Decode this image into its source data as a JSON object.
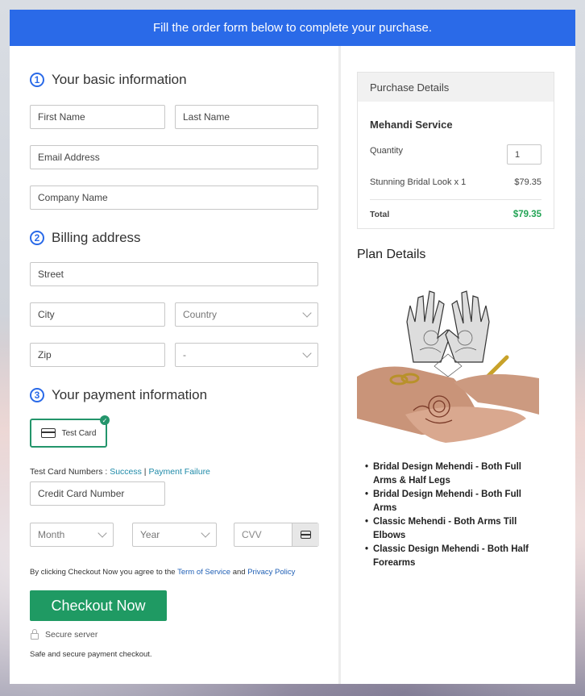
{
  "banner": "Fill the order form below to complete your purchase.",
  "sections": {
    "basic": {
      "number": "1",
      "title": "Your basic information"
    },
    "billing": {
      "number": "2",
      "title": "Billing address"
    },
    "payment": {
      "number": "3",
      "title": "Your payment information"
    }
  },
  "fields": {
    "first_name": "First Name",
    "last_name": "Last Name",
    "email": "Email Address",
    "company": "Company Name",
    "street": "Street",
    "city": "City",
    "country": "Country",
    "zip": "Zip",
    "state": "-",
    "card_number": "Credit Card Number",
    "month": "Month",
    "year": "Year",
    "cvv": "CVV"
  },
  "payment": {
    "test_card_label": "Test Card",
    "test_numbers_prefix": "Test Card Numbers : ",
    "success_link": "Success",
    "separator": " | ",
    "failure_link": "Payment Failure"
  },
  "terms": {
    "prefix": "By clicking Checkout Now you agree to the ",
    "tos": "Term of Service",
    "and": " and ",
    "privacy": "Privacy Policy"
  },
  "checkout_label": "Checkout Now",
  "secure_server": "Secure server",
  "safe_text": "Safe and secure payment checkout.",
  "purchase": {
    "header": "Purchase Details",
    "product": "Mehandi Service",
    "quantity_label": "Quantity",
    "quantity_value": "1",
    "item_label": "Stunning Bridal Look x 1",
    "item_price": "$79.35",
    "total_label": "Total",
    "total_value": "$79.35"
  },
  "plan": {
    "title": "Plan Details",
    "features": [
      "Bridal Design Mehendi - Both Full Arms & Half Legs",
      "Bridal Design Mehendi - Both Full Arms",
      "Classic Mehendi - Both Arms Till Elbows",
      "Classic Design Mehendi - Both Half Forearms"
    ]
  },
  "colors": {
    "accent": "#2a6ae8",
    "checkout": "#1f9a63",
    "total": "#23a455"
  }
}
